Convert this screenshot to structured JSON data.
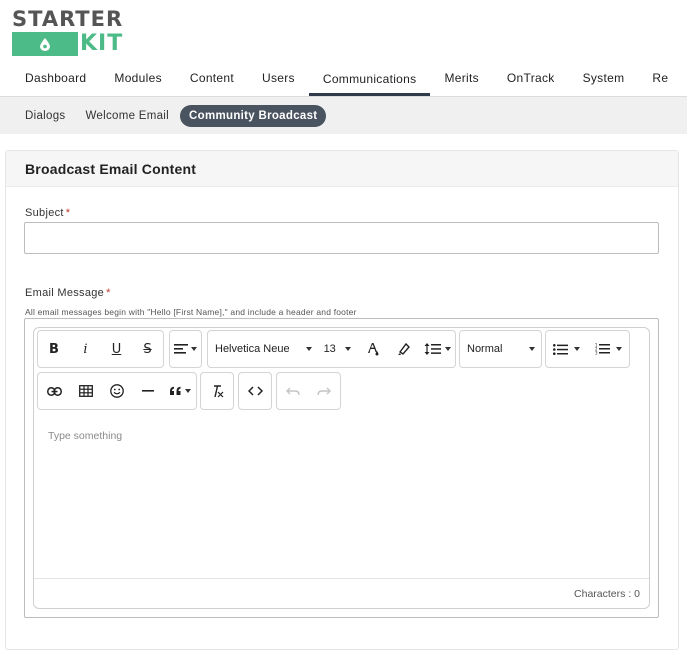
{
  "logo": {
    "top_text": "STARTER",
    "bottom_text": "KIT"
  },
  "nav": {
    "items": [
      {
        "label": "Dashboard"
      },
      {
        "label": "Modules"
      },
      {
        "label": "Content"
      },
      {
        "label": "Users"
      },
      {
        "label": "Communications"
      },
      {
        "label": "Merits"
      },
      {
        "label": "OnTrack"
      },
      {
        "label": "System"
      },
      {
        "label": "Re"
      }
    ],
    "active": "Communications"
  },
  "subnav": {
    "items": [
      {
        "label": "Dialogs"
      },
      {
        "label": "Welcome Email"
      },
      {
        "label": "Community Broadcast"
      }
    ],
    "active": "Community Broadcast"
  },
  "panel": {
    "title": "Broadcast Email Content"
  },
  "subject": {
    "label": "Subject",
    "required_mark": "*",
    "value": ""
  },
  "message": {
    "label": "Email Message",
    "required_mark": "*",
    "hint": "All email messages begin with \"Hello [First Name],\" and include a header and footer"
  },
  "editor": {
    "font_family": "Helvetica Neue",
    "font_size": "13",
    "paragraph_style": "Normal",
    "placeholder": "Type something",
    "char_count_label": "Characters : 0"
  },
  "colors": {
    "accent": "#4cbb87",
    "nav_active": "#2f3a4a",
    "pill_active": "#4a5360",
    "required": "#c0392b"
  }
}
